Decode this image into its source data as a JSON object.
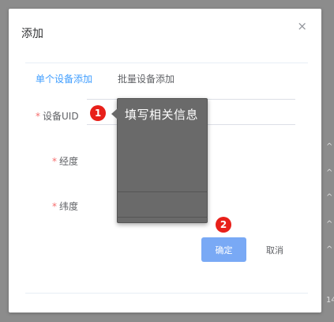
{
  "dialog": {
    "title": "添加",
    "close_symbol": "×"
  },
  "tabs": [
    {
      "label": "单个设备添加",
      "active": true
    },
    {
      "label": "批量设备添加",
      "active": false
    }
  ],
  "form": {
    "required_mark": "*",
    "fields": [
      {
        "label": "设备UID"
      },
      {
        "label": "经度"
      },
      {
        "label": "纬度"
      }
    ]
  },
  "tooltip": {
    "text": "填写相关信息"
  },
  "steps": [
    "1",
    "2"
  ],
  "buttons": {
    "confirm": "确定",
    "cancel": "取消"
  },
  "background_edge": {
    "chars": [
      "^",
      "^",
      "^",
      "^",
      "^",
      "14"
    ]
  },
  "colors": {
    "accent": "#409eff",
    "confirm_bg": "#79a9f5",
    "badge": "#e8201a",
    "required": "#f56c6c",
    "overlay": "#6a6a6a"
  }
}
